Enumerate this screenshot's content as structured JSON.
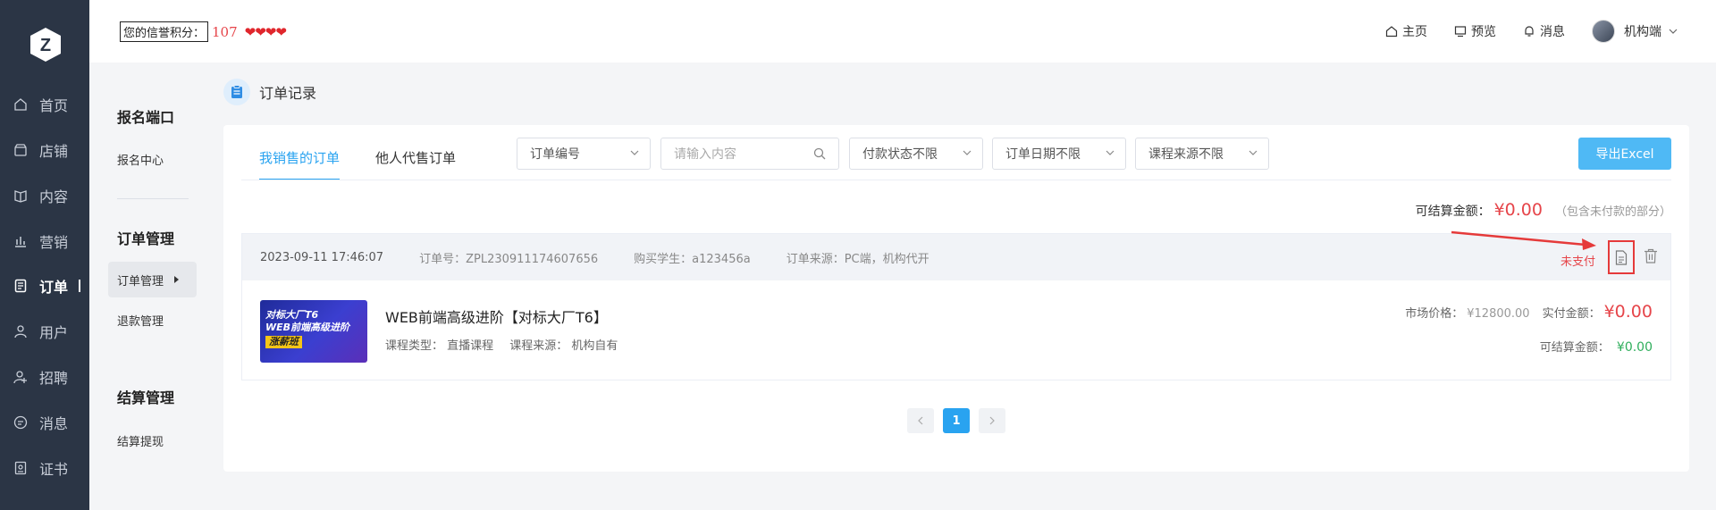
{
  "header": {
    "credit_label": "您的信誉积分：",
    "credit_value": "107",
    "links": [
      {
        "label": "主页",
        "icon": "home-icon"
      },
      {
        "label": "预览",
        "icon": "monitor-icon"
      },
      {
        "label": "消息",
        "icon": "bell-icon"
      }
    ],
    "user_name": "机构端"
  },
  "leftnav": {
    "items": [
      {
        "label": "首页",
        "icon": "home-icon"
      },
      {
        "label": "店铺",
        "icon": "shop-icon"
      },
      {
        "label": "内容",
        "icon": "book-icon"
      },
      {
        "label": "营销",
        "icon": "chart-icon"
      },
      {
        "label": "订单",
        "icon": "order-icon",
        "active": true
      },
      {
        "label": "用户",
        "icon": "user-icon"
      },
      {
        "label": "招聘",
        "icon": "recruit-icon"
      },
      {
        "label": "消息",
        "icon": "message-icon"
      },
      {
        "label": "证书",
        "icon": "certificate-icon"
      }
    ]
  },
  "subnav": {
    "section1": {
      "title": "报名端口",
      "items": [
        "报名中心"
      ]
    },
    "section2": {
      "title": "订单管理",
      "items": [
        "订单管理",
        "退款管理"
      ]
    },
    "section3": {
      "title": "结算管理",
      "items": [
        "结算提现"
      ]
    }
  },
  "page": {
    "title": "订单记录",
    "tabs": [
      "我销售的订单",
      "他人代售订单"
    ],
    "filters": {
      "order_no": "订单编号",
      "search_placeholder": "请输入内容",
      "pay_status": "付款状态不限",
      "order_date": "订单日期不限",
      "course_source": "课程来源不限"
    },
    "export_label": "导出Excel",
    "settle_label": "可结算金额：",
    "settle_amount": "¥0.00",
    "settle_note": "（包含未付款的部分）"
  },
  "order": {
    "datetime": "2023-09-11 17:46:07",
    "order_no": "订单号：ZPL230911174607656",
    "buyer": "购买学生：a123456a",
    "source": "订单来源：PC端，机构代开",
    "status": "未支付",
    "thumb_line1": "对标大厂T6",
    "thumb_line2": "WEB前端高级进阶",
    "thumb_line3": "涨薪班",
    "course_title": "WEB前端高级进阶【对标大厂T6】",
    "course_type": "课程类型： 直播课程",
    "course_source": "课程来源： 机构自有",
    "market_label": "市场价格：",
    "market_price": "¥12800.00",
    "paid_label": "实付金额：",
    "paid_amount": "¥0.00",
    "settle_label": "可结算金额：",
    "settle_amount": "¥0.00"
  },
  "pager": {
    "current": "1"
  },
  "colors": {
    "accent": "#29a3f0",
    "danger": "#e6454a",
    "nav_bg": "#2b3545"
  }
}
